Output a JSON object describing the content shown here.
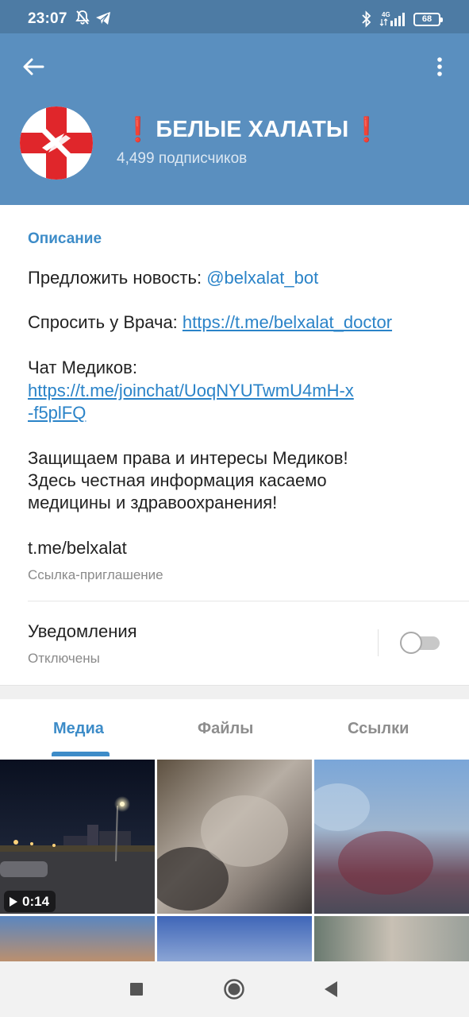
{
  "status_bar": {
    "time": "23:07",
    "network": "4G",
    "battery": "68"
  },
  "header": {
    "title": "БЕЛЫЕ ХАЛАТЫ",
    "title_emoji": "❗",
    "subscribers": "4,499 подписчиков",
    "accent_color": "#5a8fbf"
  },
  "info": {
    "section_title": "Описание",
    "suggest_label": "Предложить новость: ",
    "suggest_link": "@belxalat_bot",
    "ask_label": "Спросить у Врача: ",
    "ask_link": "https://t.me/belxalat_doctor",
    "chat_label": "Чат Медиков:",
    "chat_link_line1": "https://t.me/joinchat/UoqNYUTwmU4mH-x",
    "chat_link_line2": "-f5plFQ",
    "about_line1": "Защищаем права и интересы Медиков!",
    "about_line2": "Здесь честная информация касаемо",
    "about_line3": "медицины и здравоохранения!",
    "invite_link": "t.me/belxalat",
    "invite_label": "Ссылка-приглашение",
    "notifications_title": "Уведомления",
    "notifications_status": "Отключены",
    "notifications_enabled": false
  },
  "tabs": {
    "items": [
      {
        "label": "Медиа",
        "active": true
      },
      {
        "label": "Файлы",
        "active": false
      },
      {
        "label": "Ссылки",
        "active": false
      }
    ],
    "active_color": "#3d8cc8"
  },
  "media": {
    "video_duration": "0:14"
  },
  "nav": {
    "icons": [
      "recents-square-icon",
      "home-circle-icon",
      "back-triangle-icon"
    ]
  }
}
